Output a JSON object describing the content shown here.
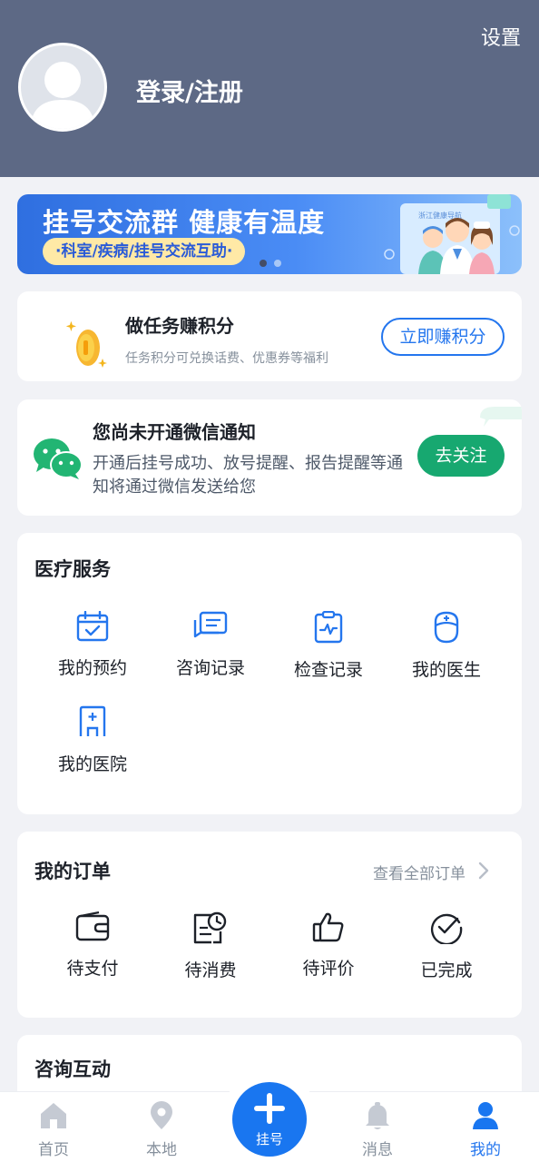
{
  "header": {
    "settings_label": "设置",
    "login_label": "登录/注册"
  },
  "banner": {
    "title": "挂号交流群 健康有温度",
    "pill": "·科室/疾病/挂号交流互助·",
    "sign_text": "浙江健康导航"
  },
  "points_card": {
    "title": "做任务赚积分",
    "subtitle": "任务积分可兑换话费、优惠券等福利",
    "button": "立即赚积分"
  },
  "wechat_card": {
    "title": "您尚未开通微信通知",
    "description": "开通后挂号成功、放号提醒、报告提醒等通知将通过微信发送给您",
    "button": "去关注"
  },
  "medical_services": {
    "title": "医疗服务",
    "items": [
      {
        "label": "我的预约",
        "icon": "calendar-check-icon"
      },
      {
        "label": "咨询记录",
        "icon": "chat-record-icon"
      },
      {
        "label": "检查记录",
        "icon": "clipboard-pulse-icon"
      },
      {
        "label": "我的医生",
        "icon": "doctor-icon"
      },
      {
        "label": "我的医院",
        "icon": "hospital-icon"
      }
    ]
  },
  "orders": {
    "title": "我的订单",
    "view_all": "查看全部订单",
    "items": [
      {
        "label": "待支付",
        "icon": "wallet-icon"
      },
      {
        "label": "待消费",
        "icon": "receipt-clock-icon"
      },
      {
        "label": "待评价",
        "icon": "thumbs-up-icon"
      },
      {
        "label": "已完成",
        "icon": "check-circle-icon"
      }
    ]
  },
  "consult": {
    "title": "咨询互动"
  },
  "tabbar": {
    "items": [
      {
        "label": "首页",
        "icon": "home-icon"
      },
      {
        "label": "本地",
        "icon": "location-pin-icon"
      },
      {
        "label": "挂号",
        "icon": "plus-icon"
      },
      {
        "label": "消息",
        "icon": "bell-icon"
      },
      {
        "label": "我的",
        "icon": "person-icon",
        "active": true
      }
    ]
  },
  "colors": {
    "header_bg": "#5d6985",
    "primary": "#2476ee",
    "wechat_green": "#17a870",
    "page_bg": "#f1f2f6"
  }
}
